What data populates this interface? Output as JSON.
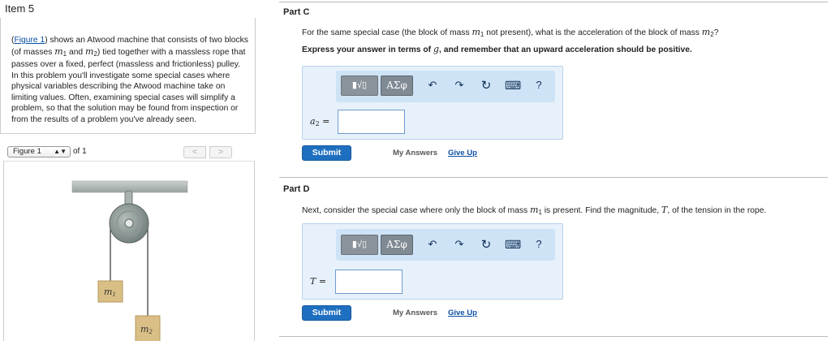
{
  "item": {
    "title": "Item 5"
  },
  "intro": {
    "link": "Figure 1",
    "seg1": ") shows an Atwood machine that consists of two blocks (of masses ",
    "m1_base": "m",
    "m1_sub": "1",
    "and": " and ",
    "m2_base": "m",
    "m2_sub": "2",
    "seg2": ") tied together with a massless rope that passes over a fixed, perfect (massless and frictionless) pulley. In this problem you'll investigate some special cases where physical variables describing the Atwood machine take on limiting values. Often, examining special cases will simplify a problem, so that the solution may be found from inspection or from the results of a problem you've already seen."
  },
  "figure": {
    "select_value": "Figure 1",
    "of_label": "of 1",
    "prev": "<",
    "next": ">",
    "block1_label": "m1",
    "block2_label": "m2"
  },
  "part_c": {
    "title": "Part C",
    "question_pre": "For the same special case (the block of mass ",
    "question_mid": " not present), what is the acceleration of the block of mass ",
    "question_post": "?",
    "instruction_pre": "Express your answer in terms of ",
    "instruction_var": "g",
    "instruction_post": ", and remember that an upward acceleration should be positive.",
    "answer_label": "a",
    "answer_sub": "2",
    "answer_eq": " =",
    "answer_value": "",
    "submit": "Submit",
    "my_answers": "My Answers",
    "give_up": "Give Up"
  },
  "part_d": {
    "title": "Part D",
    "question_pre": "Next, consider the special case where only the block of mass ",
    "question_mid": " is present. Find the magnitude, ",
    "question_var": "T",
    "question_post": ", of the tension in the rope.",
    "answer_label": "T",
    "answer_eq": " =",
    "answer_value": "",
    "submit": "Submit",
    "my_answers": "My Answers",
    "give_up": "Give Up"
  },
  "toolbar": {
    "templates_icon": "templates-icon",
    "greek_label": "ΑΣφ",
    "undo_icon": "undo-icon",
    "redo_icon": "redo-icon",
    "reset_icon": "reset-icon",
    "keyboard_icon": "keyboard-icon",
    "help_label": "?"
  },
  "colors": {
    "link": "#0b4fa5",
    "submit_bg": "#1f6fc0",
    "panel_bg": "#e7f1fb",
    "toolbar_bg": "#cfe3f6",
    "block_tan": "#d9bf86"
  }
}
